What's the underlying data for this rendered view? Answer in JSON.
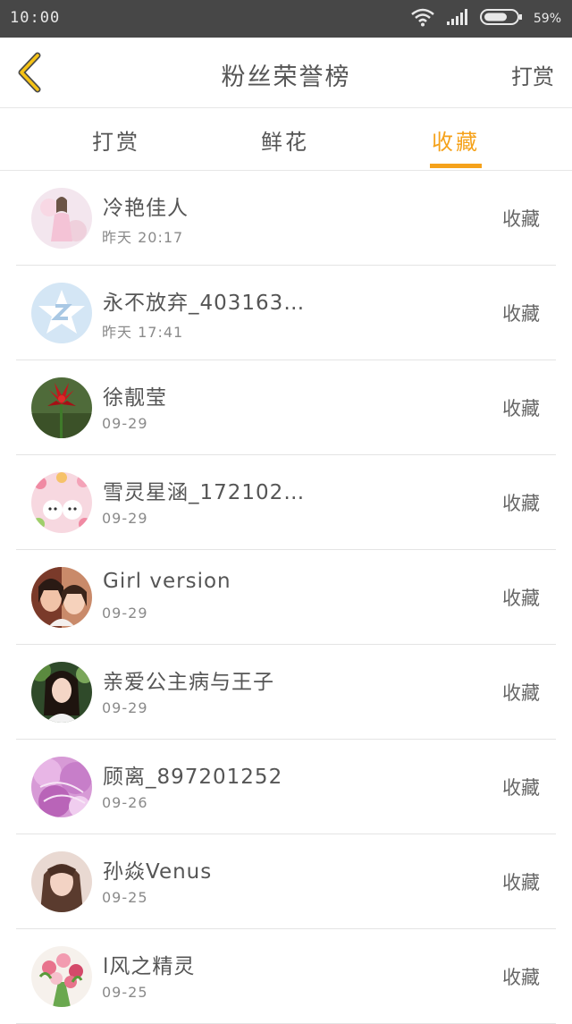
{
  "status_bar": {
    "time": "10:00",
    "battery": "59%"
  },
  "nav": {
    "title": "粉丝荣誉榜",
    "right_action": "打赏"
  },
  "tabs": [
    {
      "label": "打赏",
      "active": false
    },
    {
      "label": "鲜花",
      "active": false
    },
    {
      "label": "收藏",
      "active": true
    }
  ],
  "colors": {
    "accent": "#f5a21b",
    "back_arrow": "#f6c315",
    "status_bar_bg": "#474747"
  },
  "fans": [
    {
      "name": "冷艳佳人",
      "time": "昨天 20:17",
      "action": "收藏",
      "avatar": "avatar-illustrated-lady"
    },
    {
      "name": "永不放弃_403163…",
      "time": "昨天 17:41",
      "action": "收藏",
      "avatar": "avatar-qzone-star"
    },
    {
      "name": "徐靓莹",
      "time": "09-29",
      "action": "收藏",
      "avatar": "avatar-red-flower"
    },
    {
      "name": "雪灵星涵_172102…",
      "time": "09-29",
      "action": "收藏",
      "avatar": "avatar-white-kittens"
    },
    {
      "name": "Girl version",
      "time": "09-29",
      "action": "收藏",
      "avatar": "avatar-two-girls"
    },
    {
      "name": "亲爱公主病与王子",
      "time": "09-29",
      "action": "收藏",
      "avatar": "avatar-girl-portrait"
    },
    {
      "name": "顾离_897201252",
      "time": "09-26",
      "action": "收藏",
      "avatar": "avatar-pink-flowers"
    },
    {
      "name": "孙焱Venus",
      "time": "09-25",
      "action": "收藏",
      "avatar": "avatar-woman-portrait"
    },
    {
      "name": "l风之精灵",
      "time": "09-25",
      "action": "收藏",
      "avatar": "avatar-flower-bouquet"
    }
  ]
}
